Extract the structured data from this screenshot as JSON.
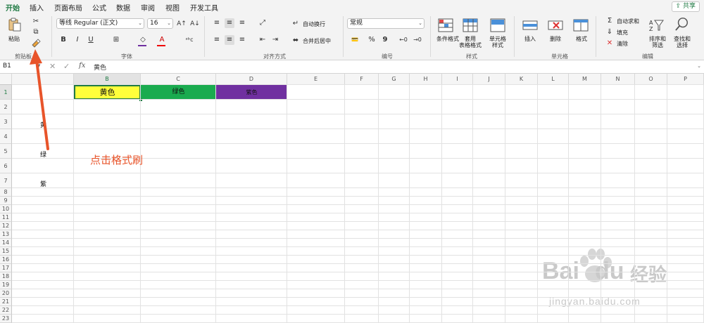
{
  "tabs": [
    "开始",
    "插入",
    "页面布局",
    "公式",
    "数据",
    "审阅",
    "视图",
    "开发工具"
  ],
  "share_label": "共享",
  "clipboard": {
    "paste_label": "粘贴",
    "group_label": "剪贴板"
  },
  "font": {
    "name": "等线 Regular (正文)",
    "size": "16",
    "group_label": "字体",
    "bold": "B",
    "italic": "I",
    "underline": "U"
  },
  "alignment": {
    "wrap_label": "自动换行",
    "merge_label": "合并后居中",
    "group_label": "对齐方式"
  },
  "number": {
    "format": "常规",
    "percent": "%",
    "comma": "9",
    "group_label": "编号"
  },
  "styles": {
    "cond_label": "条件格式",
    "table_label": "套用\n表格格式",
    "cell_label": "单元格\n样式",
    "group_label": "样式"
  },
  "cells": {
    "insert_label": "插入",
    "delete_label": "删除",
    "format_label": "格式",
    "group_label": "单元格"
  },
  "editing": {
    "autosum_label": "自动求和",
    "fill_label": "填充",
    "clear_label": "清除",
    "sort_label": "排序和\n筛选",
    "find_label": "查找和\n选择",
    "group_label": "编辑"
  },
  "formula_bar": {
    "cell_ref": "B1",
    "fx": "fx",
    "content": "黄色"
  },
  "columns": [
    "B",
    "C",
    "D",
    "E",
    "F",
    "G",
    "H",
    "I",
    "J",
    "K",
    "L",
    "M",
    "N",
    "O",
    "P"
  ],
  "rows": [
    "1",
    "2",
    "3",
    "4",
    "5",
    "6",
    "7",
    "8",
    "9",
    "10",
    "11",
    "12",
    "13",
    "14",
    "15",
    "16",
    "17",
    "18",
    "19",
    "20",
    "21",
    "22",
    "23"
  ],
  "cells_data": {
    "b1": "黄色",
    "c1": "绿色",
    "d1": "紫色",
    "a3": "黄",
    "a5": "绿",
    "a7": "紫"
  },
  "colors": {
    "yellow": "#ffff3b",
    "green": "#1aab4f",
    "purple": "#7030a0",
    "accent": "#1f7a43",
    "annotation": "#e8542a"
  },
  "annotation": "点击格式刷",
  "watermark": {
    "brand": "Bai",
    "brand2": "du",
    "brand_cn": "经验",
    "url": "jingyan.baidu.com"
  }
}
